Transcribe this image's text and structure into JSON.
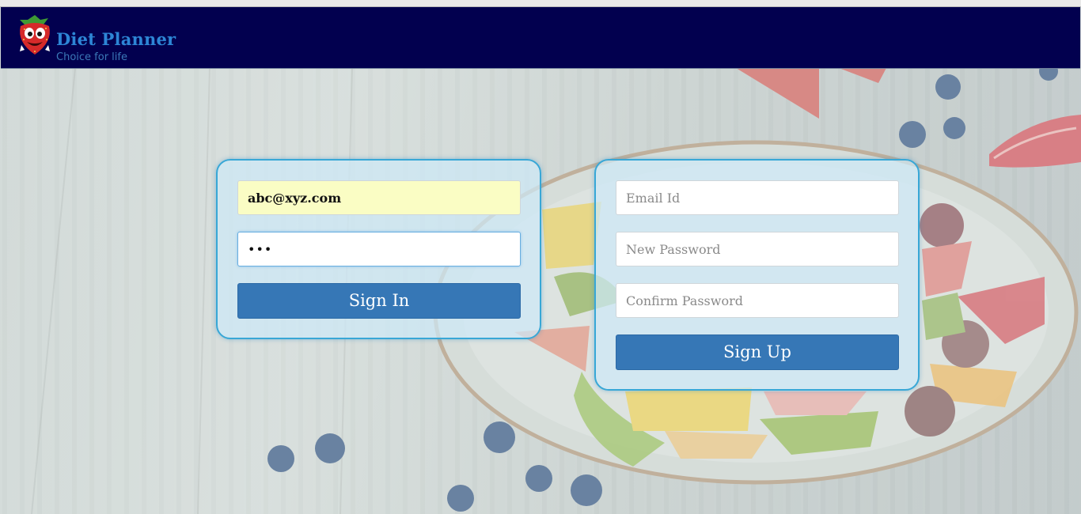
{
  "header": {
    "brand": "Diet Planner",
    "tagline": "Choice for life",
    "logo_icon": "strawberry-mascot-icon",
    "background_color": "#02004f"
  },
  "signin": {
    "email_value": "abc@xyz.com",
    "password_value": "•••",
    "button_label": "Sign In"
  },
  "signup": {
    "email_placeholder": "Email Id",
    "new_password_placeholder": "New Password",
    "confirm_password_placeholder": "Confirm Password",
    "button_label": "Sign Up"
  },
  "colors": {
    "button": "#3677b6",
    "card_border": "#38a7d6",
    "autofill": "#fafdc4"
  }
}
